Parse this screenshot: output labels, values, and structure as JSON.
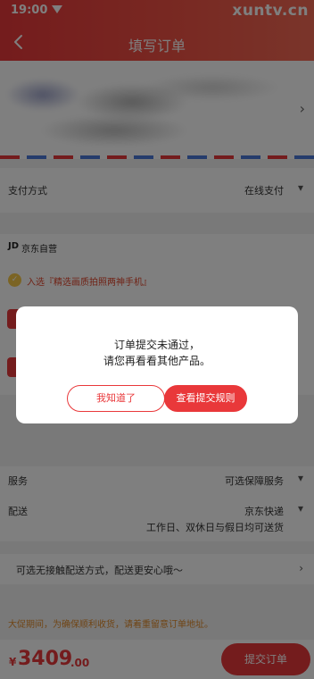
{
  "status_bar": {
    "time": "19:00"
  },
  "watermark": "xuntv.cn",
  "header": {
    "title": "填写订单"
  },
  "payment": {
    "label": "支付方式",
    "value": "在线支付"
  },
  "shop": {
    "logo": "JD",
    "name": "京东自营"
  },
  "promo": {
    "text": "入选『精选画质拍照两神手机』"
  },
  "service": {
    "label": "服务",
    "value": "可选保障服务"
  },
  "delivery": {
    "label": "配送",
    "value": "京东快递",
    "time": "工作日、双休日与假日均可送货"
  },
  "contactless": {
    "text": "可选无接触配送方式，配送更安心哦～"
  },
  "notice": {
    "text": "大促期间，为确保顺利收货，请着重留意订单地址。"
  },
  "dialog": {
    "line1": "订单提交未通过，",
    "line2": "请您再看看其他产品。",
    "btn_known": "我知道了",
    "btn_rules": "查看提交规则"
  },
  "bottom": {
    "currency": "¥",
    "price_int": "3409",
    "price_dec": ".00",
    "submit": "提交订单"
  },
  "colors": {
    "accent": "#e9383a"
  }
}
